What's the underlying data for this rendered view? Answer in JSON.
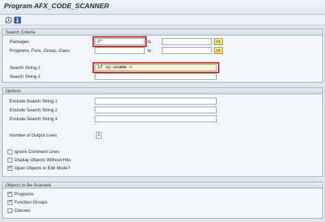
{
  "window": {
    "title": "Program AFX_CODE_SCANNER"
  },
  "toolbar": {
    "execute_icon": "execute-icon",
    "info_icon": "info-icon"
  },
  "search_criteria": {
    "heading": "Search Criteria",
    "packages_label": "Packages",
    "packages_value": "z*",
    "packages_to_label": "to",
    "packages_to_value": "",
    "programs_label": "Programs, Func. Group, Class",
    "programs_value": "",
    "programs_to_label": "to",
    "programs_to_value": "",
    "search_string_1_label": "Search String 1",
    "search_string_1_value": "if sy-uname =",
    "search_string_2_label": "Search String 2",
    "search_string_2_value": ""
  },
  "options": {
    "heading": "Options",
    "exclude_1_label": "Exclude Search String 1",
    "exclude_2_label": "Exclude Search String 2",
    "exclude_3_label": "Exclude Search String 3",
    "output_lines_label": "Number of Output Lines",
    "output_lines_value": "1",
    "ignore_comments_label": "Ignore Comment Lines",
    "ignore_comments_checked": false,
    "display_without_hits_label": "Display Objects Without Hits",
    "display_without_hits_checked": false,
    "open_edit_mode_label": "Open Objects in Edit Mode?",
    "open_edit_mode_checked": true
  },
  "objects": {
    "heading": "Objects to Be Scanned",
    "programs_label": "Programs",
    "programs_checked": true,
    "function_groups_label": "Function Groups",
    "function_groups_checked": true,
    "classes_label": "Classes",
    "classes_checked": false
  },
  "check_glyph": "✓",
  "multi_select_glyph": "⇨"
}
